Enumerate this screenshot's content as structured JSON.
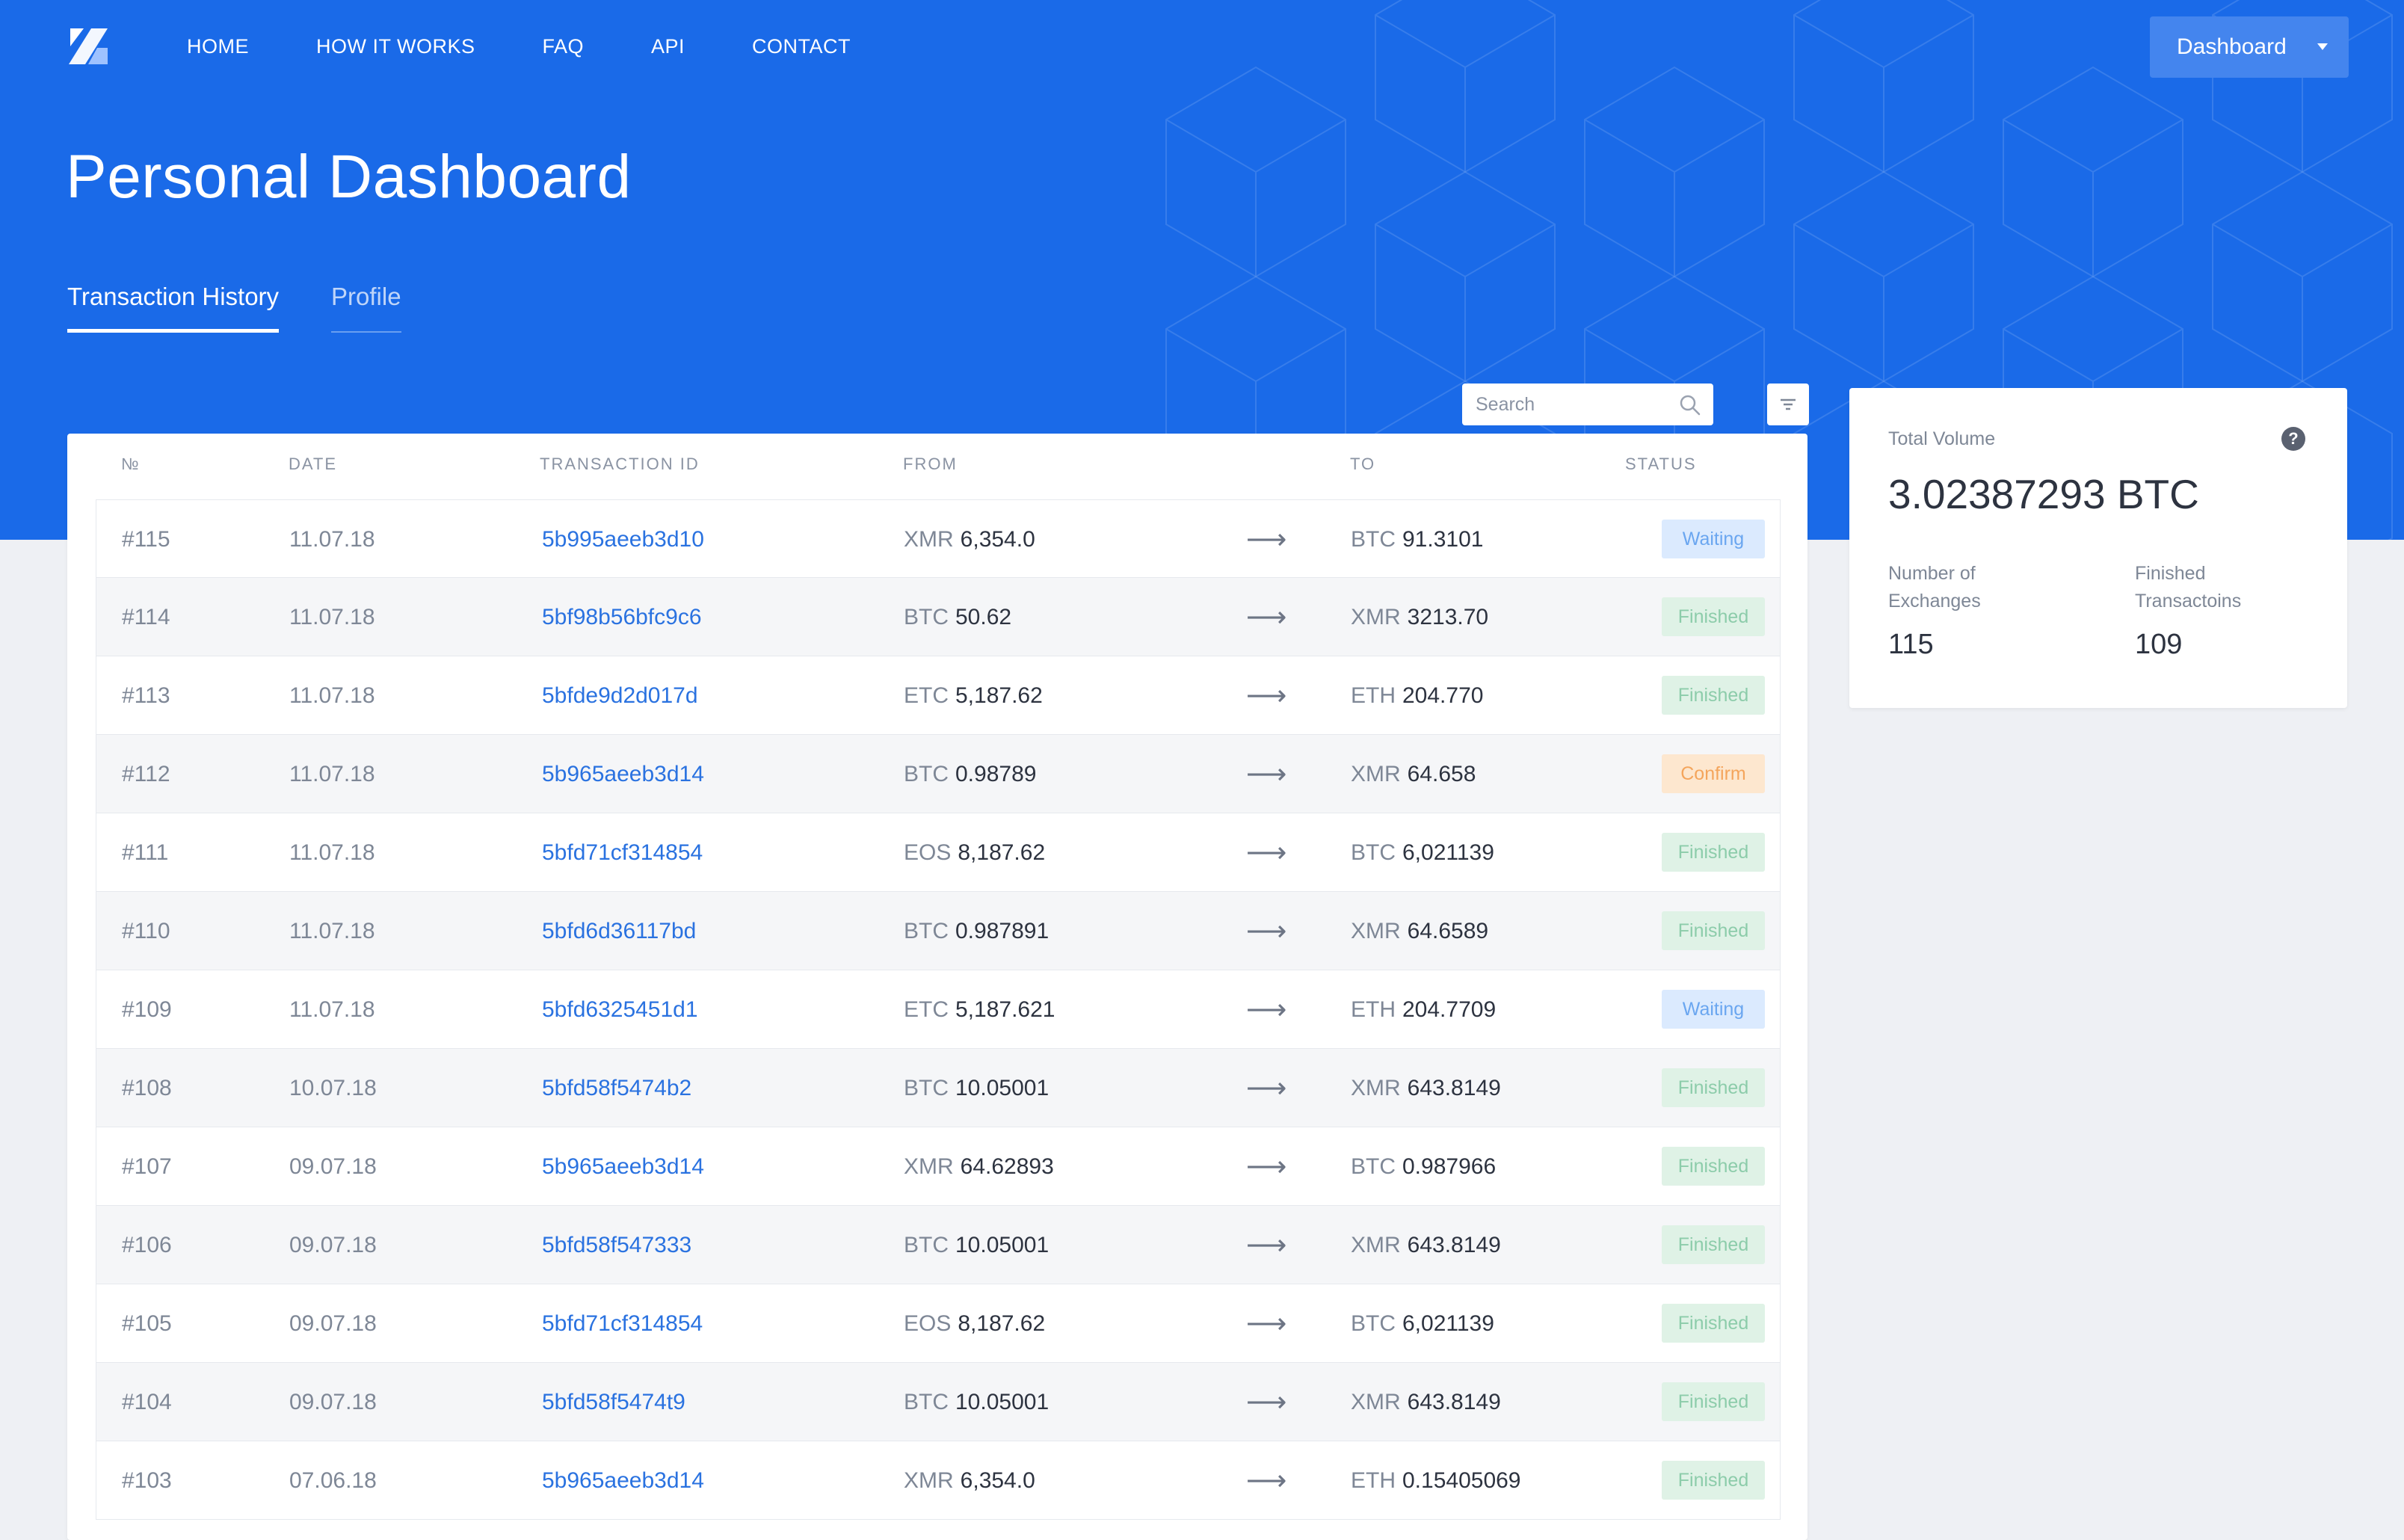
{
  "nav": {
    "items": [
      "HOME",
      "HOW IT WORKS",
      "FAQ",
      "API",
      "CONTACT"
    ],
    "dashboard_label": "Dashboard"
  },
  "page_title": "Personal Dashboard",
  "tabs": [
    {
      "label": "Transaction History",
      "active": true
    },
    {
      "label": "Profile",
      "active": false
    }
  ],
  "search": {
    "placeholder": "Search"
  },
  "table": {
    "headers": {
      "num": "№",
      "date": "DATE",
      "tx": "TRANSACTION ID",
      "from": "FROM",
      "to": "TO",
      "status": "STATUS"
    },
    "arrow": "⟶",
    "rows": [
      {
        "num": "#115",
        "date": "11.07.18",
        "tx": "5b995aeeb3d10",
        "from_cur": "XMR",
        "from_amt": "6,354.0",
        "to_cur": "BTC",
        "to_amt": "91.3101",
        "status": "Waiting"
      },
      {
        "num": "#114",
        "date": "11.07.18",
        "tx": "5bf98b56bfc9c6",
        "from_cur": "BTC",
        "from_amt": "50.62",
        "to_cur": "XMR",
        "to_amt": "3213.70",
        "status": "Finished"
      },
      {
        "num": "#113",
        "date": "11.07.18",
        "tx": "5bfde9d2d017d",
        "from_cur": "ETC",
        "from_amt": "5,187.62",
        "to_cur": "ETH",
        "to_amt": "204.770",
        "status": "Finished"
      },
      {
        "num": "#112",
        "date": "11.07.18",
        "tx": "5b965aeeb3d14",
        "from_cur": "BTC",
        "from_amt": "0.98789",
        "to_cur": "XMR",
        "to_amt": "64.658",
        "status": "Confirm"
      },
      {
        "num": "#111",
        "date": "11.07.18",
        "tx": "5bfd71cf314854",
        "from_cur": "EOS",
        "from_amt": "8,187.62",
        "to_cur": "BTC",
        "to_amt": "6,021139",
        "status": "Finished"
      },
      {
        "num": "#110",
        "date": "11.07.18",
        "tx": "5bfd6d36117bd",
        "from_cur": "BTC",
        "from_amt": "0.987891",
        "to_cur": "XMR",
        "to_amt": "64.6589",
        "status": "Finished"
      },
      {
        "num": "#109",
        "date": "11.07.18",
        "tx": "5bfd6325451d1",
        "from_cur": "ETC",
        "from_amt": "5,187.621",
        "to_cur": "ETH",
        "to_amt": "204.7709",
        "status": "Waiting"
      },
      {
        "num": "#108",
        "date": "10.07.18",
        "tx": "5bfd58f5474b2",
        "from_cur": "BTC",
        "from_amt": "10.05001",
        "to_cur": "XMR",
        "to_amt": "643.8149",
        "status": "Finished"
      },
      {
        "num": "#107",
        "date": "09.07.18",
        "tx": "5b965aeeb3d14",
        "from_cur": "XMR",
        "from_amt": "64.62893",
        "to_cur": "BTC",
        "to_amt": "0.987966",
        "status": "Finished"
      },
      {
        "num": "#106",
        "date": "09.07.18",
        "tx": "5bfd58f547333",
        "from_cur": "BTC",
        "from_amt": "10.05001",
        "to_cur": "XMR",
        "to_amt": "643.8149",
        "status": "Finished"
      },
      {
        "num": "#105",
        "date": "09.07.18",
        "tx": "5bfd71cf314854",
        "from_cur": "EOS",
        "from_amt": "8,187.62",
        "to_cur": "BTC",
        "to_amt": "6,021139",
        "status": "Finished"
      },
      {
        "num": "#104",
        "date": "09.07.18",
        "tx": "5bfd58f5474t9",
        "from_cur": "BTC",
        "from_amt": "10.05001",
        "to_cur": "XMR",
        "to_amt": "643.8149",
        "status": "Finished"
      },
      {
        "num": "#103",
        "date": "07.06.18",
        "tx": "5b965aeeb3d14",
        "from_cur": "XMR",
        "from_amt": "6,354.0",
        "to_cur": "ETH",
        "to_amt": "0.15405069",
        "status": "Finished"
      }
    ]
  },
  "stats": {
    "total_volume_label": "Total Volume",
    "total_volume_value": "3.02387293 BTC",
    "help_glyph": "?",
    "exchanges_label_1": "Number of",
    "exchanges_label_2": "Exchanges",
    "exchanges_value": "115",
    "finished_label_1": "Finished",
    "finished_label_2": "Transactoins",
    "finished_value": "109"
  },
  "colors": {
    "brand_blue": "#1a6ae8",
    "link": "#2a72e0",
    "waiting": "#6aa6f0",
    "finished": "#8cccaa",
    "confirm": "#f4a55c"
  }
}
